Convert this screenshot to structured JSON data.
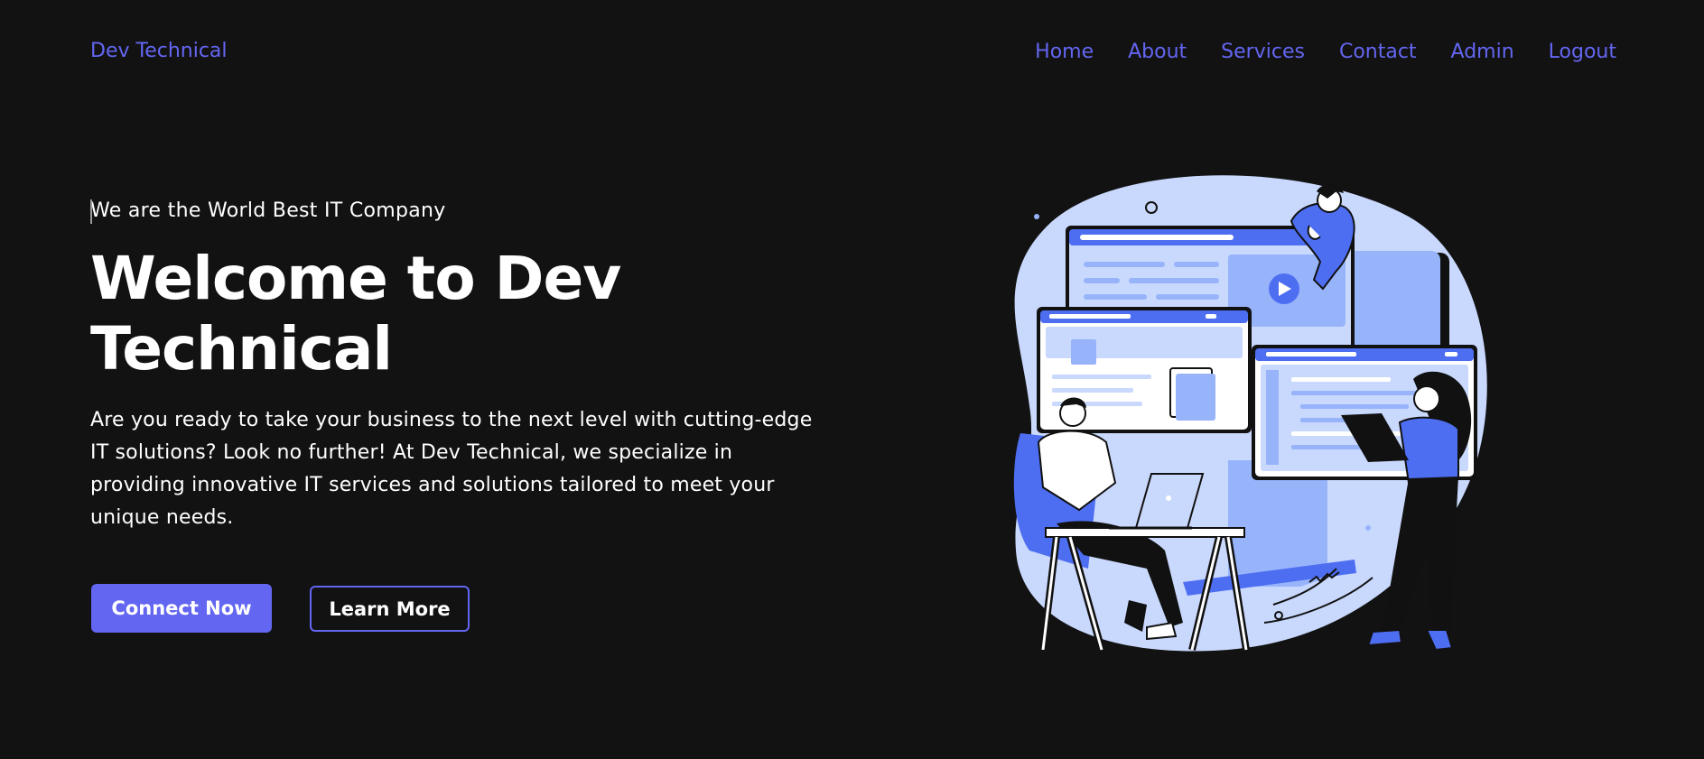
{
  "brand": {
    "name": "Dev Technical"
  },
  "nav": {
    "items": [
      {
        "label": "Home"
      },
      {
        "label": "About"
      },
      {
        "label": "Services"
      },
      {
        "label": "Contact"
      },
      {
        "label": "Admin"
      },
      {
        "label": "Logout"
      }
    ]
  },
  "hero": {
    "tagline": "We are the World Best IT Company",
    "title": "Welcome to Dev Technical",
    "description": "Are you ready to take your business to the next level with cutting-edge IT solutions? Look no further! At Dev Technical, we specialize in providing innovative IT services and solutions tailored to meet your unique needs.",
    "primary_button": "Connect Now",
    "secondary_button": "Learn More"
  },
  "colors": {
    "background": "#121212",
    "accent": "#6366f1",
    "text": "#ffffff",
    "illustration_blue": "#4e6ef2",
    "illustration_light_blue": "#c9d8fd",
    "illustration_mid_blue": "#97b4fb"
  }
}
